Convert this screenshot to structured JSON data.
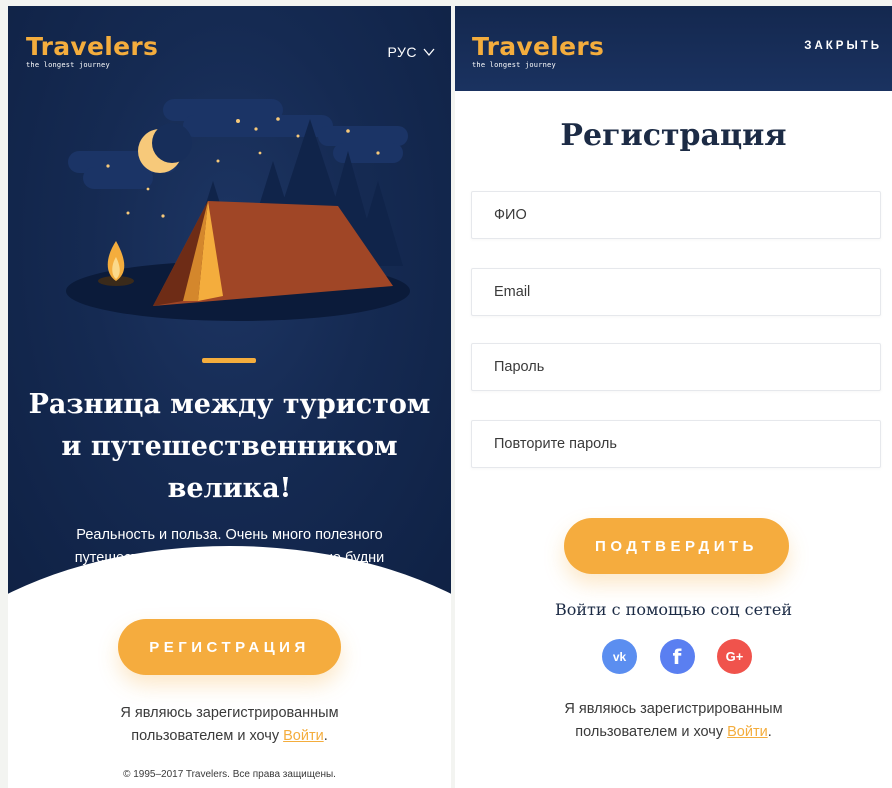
{
  "left": {
    "logo": {
      "title": "Travelers",
      "subtitle": "the longest journey"
    },
    "language": "РУС",
    "headline": "Разница между туристом и путешественником велика!",
    "lead": "Реальность и польза. Очень много полезного путешественникам спрятаны реальные будни настоящей жизни, как это часто бывает в блогах.",
    "register_button": "РЕГИСТРАЦИЯ",
    "already_text": "Я являюсь зарегистрированным пользователем и хочу",
    "login_link": "Войти",
    "period": ".",
    "copyright": "© 1995–2017 Travelers. Все права защищены."
  },
  "right": {
    "logo": {
      "title": "Travelers",
      "subtitle": "the longest journey"
    },
    "close": "ЗАКРЫТЬ",
    "title": "Регистрация",
    "fields": {
      "name_placeholder": "ФИО",
      "email_placeholder": "Email",
      "password_placeholder": "Пароль",
      "repeat_placeholder": "Повторите пароль"
    },
    "confirm_button": "ПОДТВЕРДИТЬ",
    "social_title": "Войти с помощью соц сетей",
    "social": {
      "vk": "vk",
      "facebook": "f",
      "google": "G+"
    },
    "already_text": "Я являюсь зарегистрированным пользователем и хочу",
    "login_link": "Войти",
    "period": "."
  },
  "colors": {
    "accent": "#f4ad3d",
    "navy": "#152a52",
    "heading": "#1c2b45",
    "vk": "#5b8ef0",
    "facebook": "#5a7ff1",
    "google": "#f0534c"
  }
}
